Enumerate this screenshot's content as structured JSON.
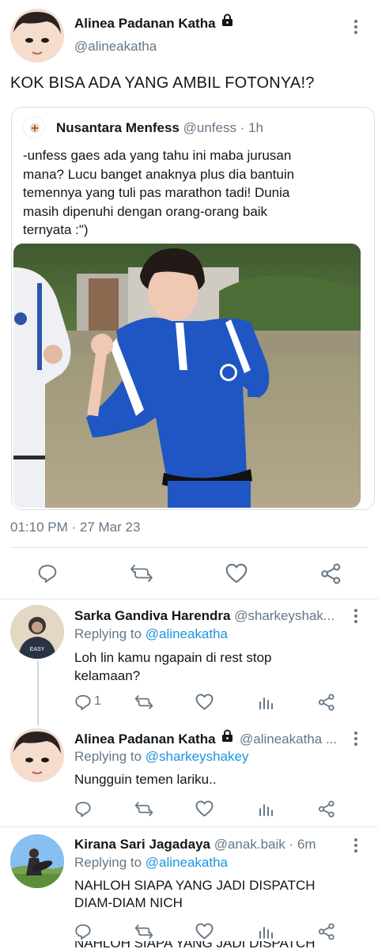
{
  "main_tweet": {
    "author_name": "Alinea Padanan Katha",
    "author_handle": "@alineakatha",
    "text": "KOK BISA ADA YANG AMBIL FOTONYA!?",
    "timestamp": "01:10 PM · 27 Mar 23",
    "quoted": {
      "author_name": "Nusantara Menfess",
      "author_handle": "@unfess",
      "time": "· 1h",
      "text": "-unfess gaes ada yang tahu ini maba jurusan mana? Lucu banget anaknya plus dia bantuin temennya yang tuli pas marathon tadi! Dunia masih dipenuhi dengan orang-orang baik ternyata :\")"
    }
  },
  "replies": [
    {
      "author_name": "Sarka Gandiva Harendra",
      "author_handle": "@sharkeyshak...",
      "replying_label": "Replying to",
      "replying_to": "@alineakatha",
      "text": "Loh lin kamu ngapain di rest stop kelamaan?",
      "reply_count": "1"
    },
    {
      "author_name": "Alinea Padanan Katha",
      "author_handle": "@alineakatha ...",
      "replying_label": "Replying to",
      "replying_to": "@sharkeyshakey",
      "text": "Nungguin temen lariku..",
      "reply_count": ""
    },
    {
      "author_name": "Kirana Sari Jagadaya",
      "author_handle": "@anak.baik",
      "time": "· 6m",
      "replying_label": "Replying to",
      "replying_to": "@alineakatha",
      "text": "NAHLOH SIAPA YANG JADI DISPATCH DIAM-DIAM NICH",
      "reply_count": ""
    }
  ],
  "cutoff_text": "NAHLOH SIAPA YANG JADI DISPATCH",
  "colors": {
    "accent": "#1b95e0",
    "secondary_text": "#657786",
    "border": "#e1e8ed"
  },
  "icons": [
    "lock-icon",
    "more-icon",
    "reply-icon",
    "retweet-icon",
    "like-icon",
    "share-icon",
    "analytics-icon"
  ]
}
